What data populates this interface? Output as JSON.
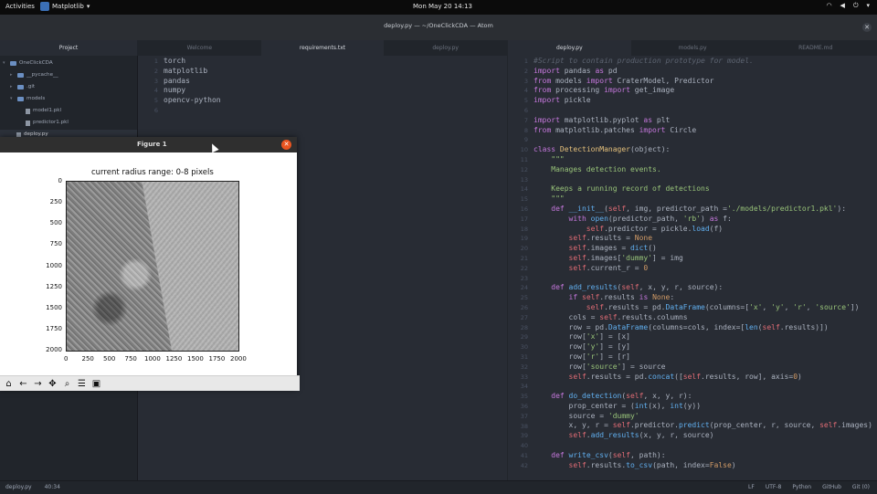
{
  "topbar": {
    "activities": "Activities",
    "app_name": "Matplotlib",
    "clock": "Mon May 20  14:13"
  },
  "window": {
    "title": "deploy.py — ~/OneClickCDA — Atom"
  },
  "tree_tab": "Project",
  "tabs_left": [
    "Welcome",
    "requirements.txt",
    "deploy.py"
  ],
  "tabs_right": [
    "deploy.py",
    "models.py",
    "README.md"
  ],
  "tree": {
    "root": "OneClickCDA",
    "items": [
      "__pycache__",
      ".git",
      "models",
      "model1.pkl",
      "predictor1.pkl",
      "deploy.py"
    ]
  },
  "left_editor": {
    "line_numbers": [
      "1",
      "2",
      "3",
      "4",
      "5",
      "6"
    ],
    "lines": [
      "torch",
      "matplotlib",
      "pandas",
      "numpy",
      "opencv-python",
      ""
    ]
  },
  "right_editor": {
    "line_numbers": [
      "1",
      "2",
      "3",
      "4",
      "5",
      "6",
      "7",
      "8",
      "9",
      "10",
      "11",
      "12",
      "13",
      "14",
      "15",
      "16",
      "17",
      "18",
      "19",
      "20",
      "21",
      "22",
      "23",
      "24",
      "25",
      "26",
      "27",
      "28",
      "29",
      "30",
      "31",
      "32",
      "33",
      "34",
      "35",
      "36",
      "37",
      "38",
      "39",
      "40",
      "41",
      "42"
    ]
  },
  "figure": {
    "window_title": "Figure 1",
    "plot_title": "current radius range: 0-8 pixels",
    "y_ticks": [
      "0",
      "250",
      "500",
      "750",
      "1000",
      "1250",
      "1500",
      "1750",
      "2000"
    ],
    "x_ticks": [
      "0",
      "250",
      "500",
      "750",
      "1000",
      "1250",
      "1500",
      "1750",
      "2000"
    ]
  },
  "status": {
    "file": "deploy.py",
    "position": "40:34",
    "eol": "LF",
    "encoding": "UTF-8",
    "grammar": "Python",
    "github": "GitHub",
    "git": "Git (0)"
  }
}
